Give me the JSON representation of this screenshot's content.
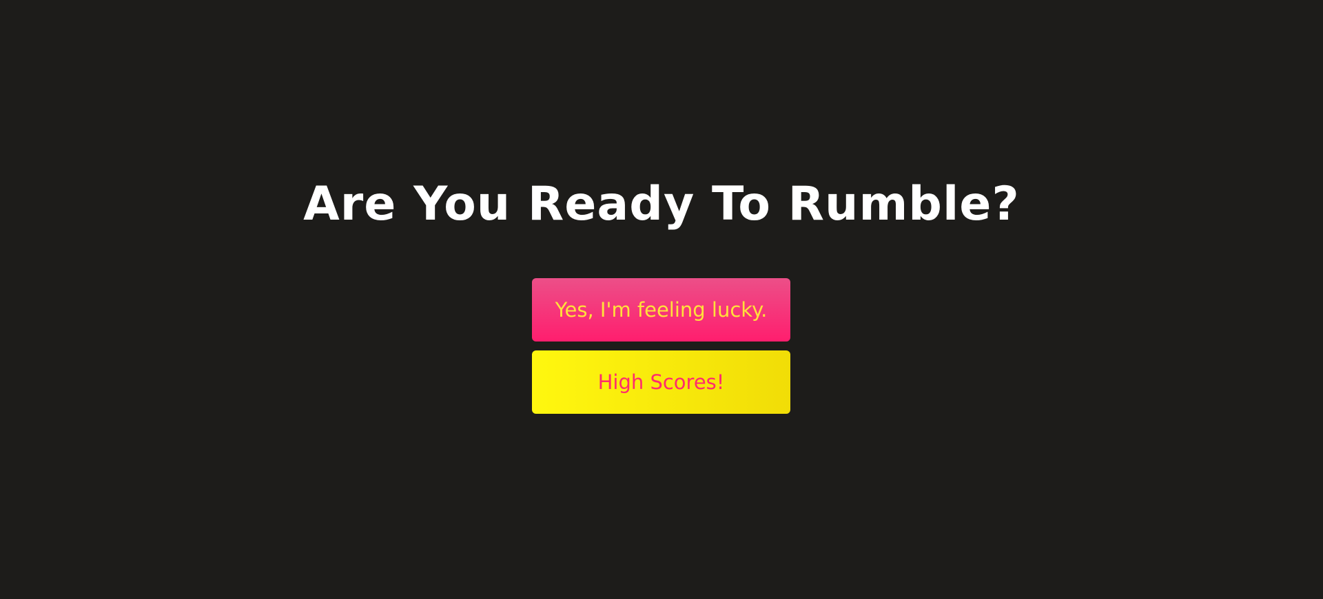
{
  "title": "Are You Ready To Rumble?",
  "menu": {
    "lucky_label": "Yes, I'm feeling lucky.",
    "scores_label": "High Scores!"
  },
  "colors": {
    "background": "#1d1c1a",
    "title": "#ffffff",
    "lucky_button": "#ff1e6e",
    "lucky_text": "#ffe23a",
    "scores_button": "#fff70f",
    "scores_text": "#ff2b6e"
  }
}
